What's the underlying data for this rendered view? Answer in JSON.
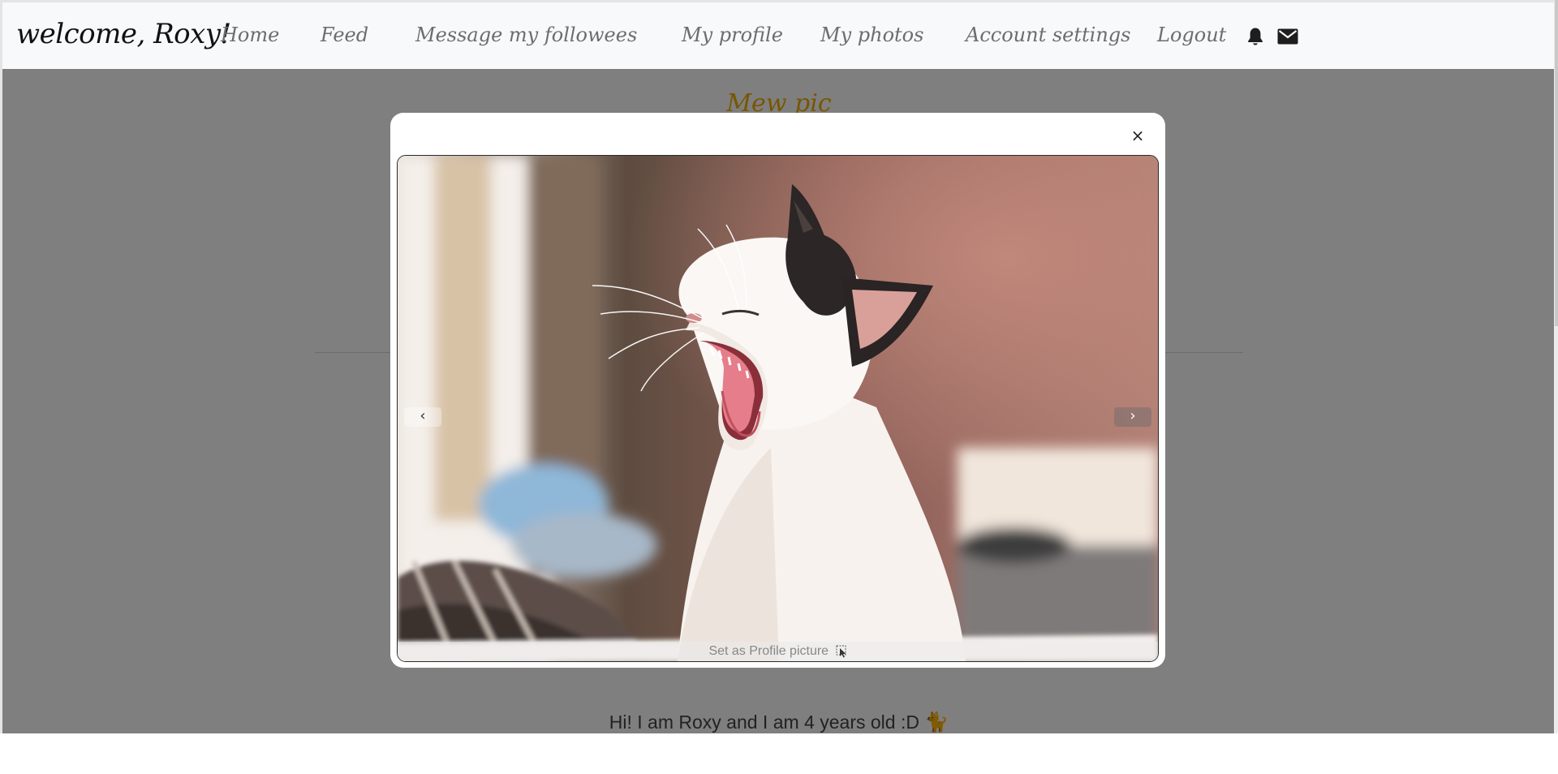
{
  "navbar": {
    "brand": "welcome, Roxy!",
    "links": [
      "Home",
      "Feed",
      "Message my followees",
      "My profile",
      "My photos",
      "Account settings",
      "Logout"
    ],
    "icons": [
      "bell-icon",
      "envelope-icon"
    ]
  },
  "page": {
    "title": "Mew pic",
    "bio": "Hi! I am Roxy and I am 4 years old :D",
    "bio_emoji": "🐈"
  },
  "modal": {
    "close_symbol": "×",
    "prev_symbol": "‹",
    "next_symbol": "›",
    "set_profile_label": "Set as Profile picture",
    "image_subject": "white and black kitten yawning"
  },
  "colors": {
    "accent_title": "#f0ad00",
    "navbar_bg": "#f8f9fa",
    "nav_link": "#6d6d6d"
  }
}
